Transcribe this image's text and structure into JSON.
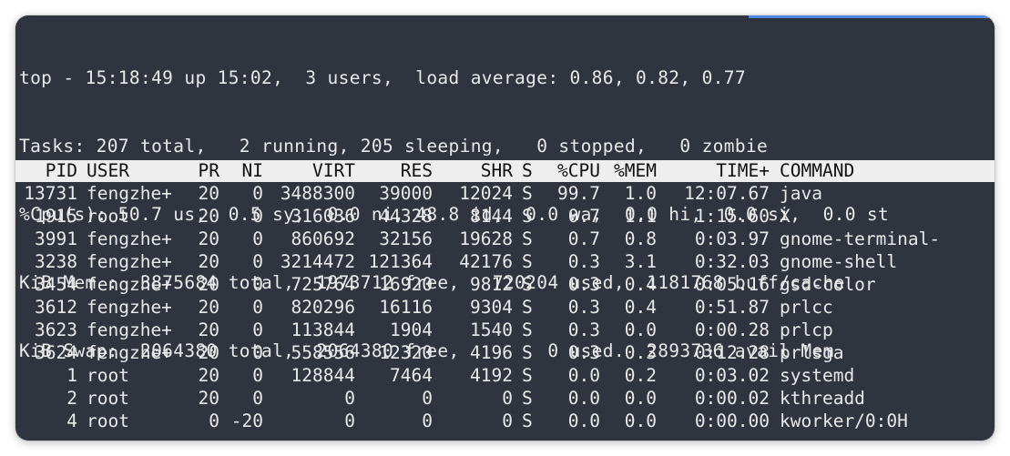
{
  "summary": {
    "lines": [
      "top - 15:18:49 up 15:02,  3 users,  load average: 0.86, 0.82, 0.77",
      "Tasks: 207 total,   2 running, 205 sleeping,   0 stopped,   0 zombie",
      "%Cpu(s): 50.7 us,  0.5 sy,  0.0 ni, 48.8 id,  0.0 wa,  0.0 hi,  0.0 si,  0.0 st",
      "KiB Mem :  3875684 total,  1973712 free,   720204 used,  1181768 buff/cache",
      "KiB Swap:  2064380 total,  2064380 free,        0 used.  2893736 avail Mem"
    ]
  },
  "table": {
    "headers": {
      "pid": "PID",
      "user": "USER",
      "pr": "PR",
      "ni": "NI",
      "virt": "VIRT",
      "res": "RES",
      "shr": "SHR",
      "s": "S",
      "cpu": "%CPU",
      "mem": "%MEM",
      "time": "TIME+",
      "command": "COMMAND"
    },
    "rows": [
      {
        "pid": "13731",
        "user": "fengzhe+",
        "pr": "20",
        "ni": "0",
        "virt": "3488300",
        "res": "39000",
        "shr": "12024",
        "s": "S",
        "cpu": "99.7",
        "mem": "1.0",
        "time": "12:07.67",
        "command": "java"
      },
      {
        "pid": "1915",
        "user": "root",
        "pr": "20",
        "ni": "0",
        "virt": "316036",
        "res": "44328",
        "shr": "8144",
        "s": "S",
        "cpu": "0.7",
        "mem": "1.1",
        "time": "1:15.60",
        "command": "X"
      },
      {
        "pid": "3991",
        "user": "fengzhe+",
        "pr": "20",
        "ni": "0",
        "virt": "860692",
        "res": "32156",
        "shr": "19628",
        "s": "S",
        "cpu": "0.7",
        "mem": "0.8",
        "time": "0:03.97",
        "command": "gnome-terminal-"
      },
      {
        "pid": "3238",
        "user": "fengzhe+",
        "pr": "20",
        "ni": "0",
        "virt": "3214472",
        "res": "121364",
        "shr": "42176",
        "s": "S",
        "cpu": "0.3",
        "mem": "3.1",
        "time": "0:32.03",
        "command": "gnome-shell"
      },
      {
        "pid": "3454",
        "user": "fengzhe+",
        "pr": "20",
        "ni": "0",
        "virt": "725764",
        "res": "16920",
        "shr": "9812",
        "s": "S",
        "cpu": "0.3",
        "mem": "0.4",
        "time": "0:05.16",
        "command": "gsd-color"
      },
      {
        "pid": "3612",
        "user": "fengzhe+",
        "pr": "20",
        "ni": "0",
        "virt": "820296",
        "res": "16116",
        "shr": "9304",
        "s": "S",
        "cpu": "0.3",
        "mem": "0.4",
        "time": "0:51.87",
        "command": "prlcc"
      },
      {
        "pid": "3623",
        "user": "fengzhe+",
        "pr": "20",
        "ni": "0",
        "virt": "113844",
        "res": "1904",
        "shr": "1540",
        "s": "S",
        "cpu": "0.3",
        "mem": "0.0",
        "time": "0:00.28",
        "command": "prlcp"
      },
      {
        "pid": "3624",
        "user": "fengzhe+",
        "pr": "20",
        "ni": "0",
        "virt": "558556",
        "res": "12320",
        "shr": "4196",
        "s": "S",
        "cpu": "0.3",
        "mem": "0.3",
        "time": "0:12.28",
        "command": "prlsga"
      },
      {
        "pid": "1",
        "user": "root",
        "pr": "20",
        "ni": "0",
        "virt": "128844",
        "res": "7464",
        "shr": "4192",
        "s": "S",
        "cpu": "0.0",
        "mem": "0.2",
        "time": "0:03.02",
        "command": "systemd"
      },
      {
        "pid": "2",
        "user": "root",
        "pr": "20",
        "ni": "0",
        "virt": "0",
        "res": "0",
        "shr": "0",
        "s": "S",
        "cpu": "0.0",
        "mem": "0.0",
        "time": "0:00.02",
        "command": "kthreadd"
      },
      {
        "pid": "4",
        "user": "root",
        "pr": "0",
        "ni": "-20",
        "virt": "0",
        "res": "0",
        "shr": "0",
        "s": "S",
        "cpu": "0.0",
        "mem": "0.0",
        "time": "0:00.00",
        "command": "kworker/0:0H"
      }
    ]
  },
  "colors": {
    "terminal_bg": "#2f343f",
    "text": "#e9e9e9",
    "header_bg": "#eeeeee",
    "accent": "#4f89e6"
  }
}
